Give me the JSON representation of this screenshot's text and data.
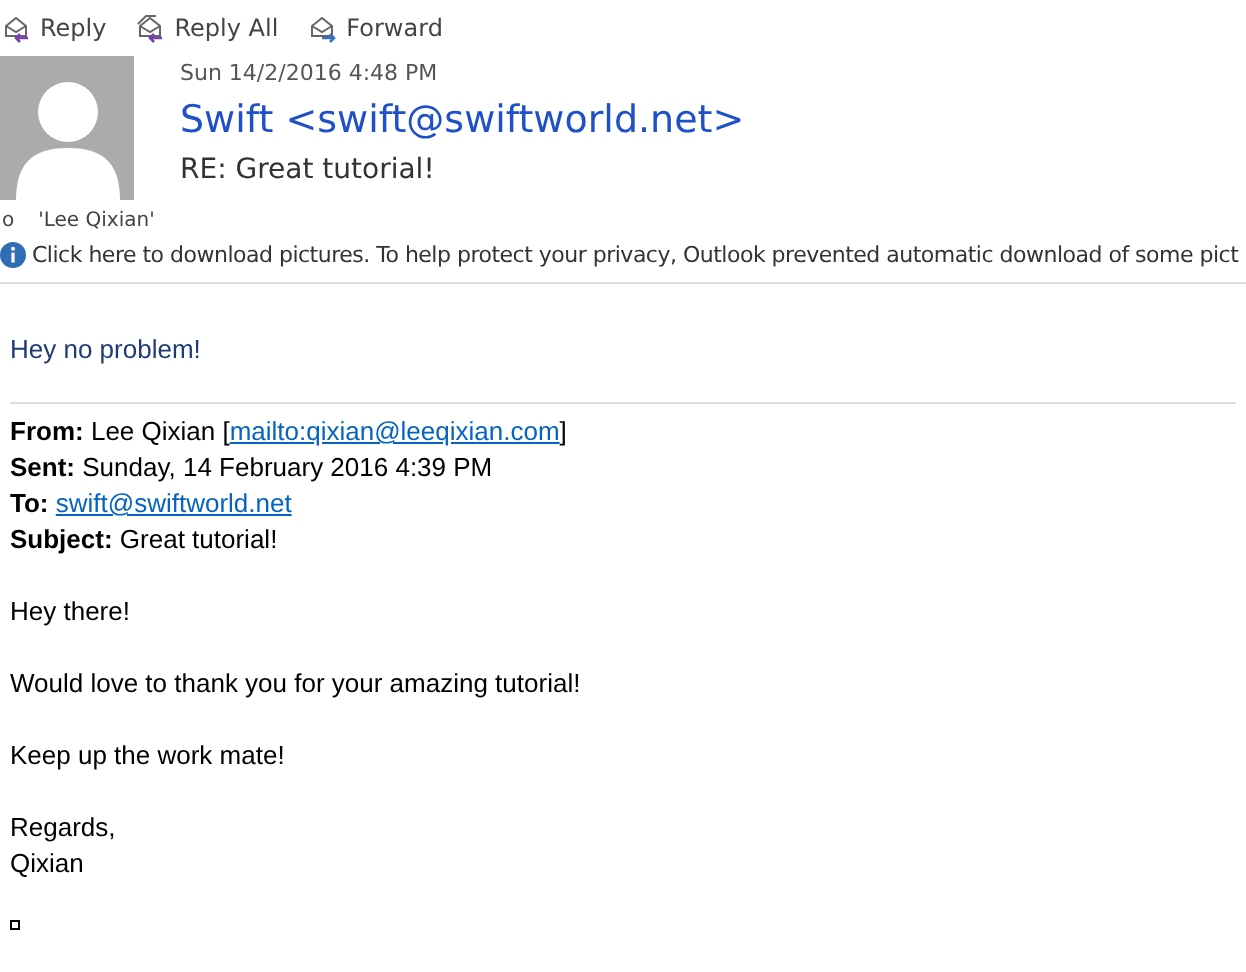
{
  "toolbar": [
    {
      "kind": "reply",
      "label": "Reply"
    },
    {
      "kind": "reply_all",
      "label": "Reply All"
    },
    {
      "kind": "forward",
      "label": "Forward"
    }
  ],
  "message": {
    "date": "Sun 14/2/2016 4:48 PM",
    "sender": "Swift <swift@swiftworld.net>",
    "subject": "RE: Great tutorial!",
    "to_label": "o",
    "to": "'Lee Qixian'"
  },
  "info_bar": "Click here to download pictures. To help protect your privacy, Outlook prevented automatic download of some pict",
  "reply_text": "Hey no problem!",
  "quoted_header": [
    {
      "label": "From:",
      "text": "Lee Qixian [",
      "link": "mailto:qixian@leeqixian.com",
      "after": "]"
    },
    {
      "label": "Sent:",
      "text": "Sunday, 14 February 2016 4:39 PM"
    },
    {
      "label": "To:",
      "link": "swift@swiftworld.net"
    },
    {
      "label": "Subject:",
      "text": "Great tutorial!"
    }
  ],
  "body": [
    [
      "Hey there!"
    ],
    [
      "Would love to thank you for your amazing tutorial!"
    ],
    [
      "Keep up the work mate!"
    ],
    [
      "Regards,",
      "Qixian"
    ]
  ]
}
